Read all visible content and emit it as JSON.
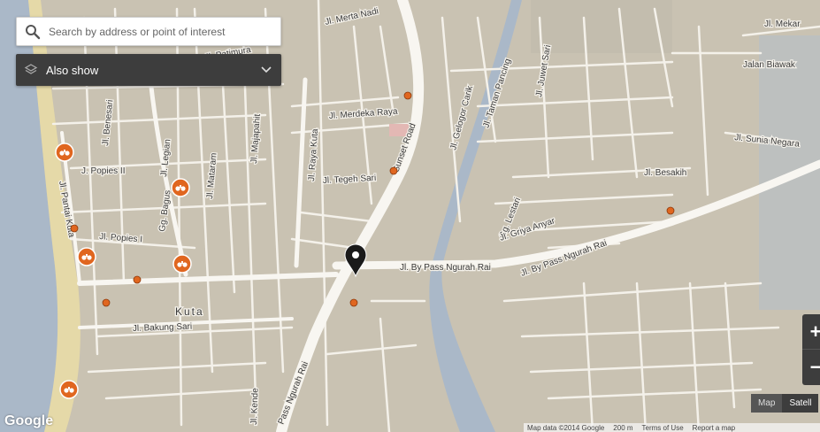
{
  "search": {
    "placeholder": "Search by address or point of interest"
  },
  "also_show": {
    "label": "Also show"
  },
  "zoom": {
    "in": "+",
    "out": "−"
  },
  "map_type": {
    "map": "Map",
    "satellite": "Satell"
  },
  "attribution": {
    "data": "Map data ©2014 Google",
    "scale": "200 m",
    "terms": "Terms of Use",
    "report": "Report a map"
  },
  "logo": {
    "text": "Google"
  },
  "icons": {
    "search": "search-icon",
    "layers": "layers-icon",
    "chevron": "chevron-down-icon",
    "marker": "location-pin-icon",
    "poi": "binoculars-icon"
  },
  "colors": {
    "land": "#c9c2b2",
    "water": "#aab8c8",
    "road": "#f4f1ea",
    "beach": "#e5d9a8",
    "poi": "#e0661f",
    "panel": "#3d3d3d"
  },
  "labels": {
    "merta_nadi": "Jl. Merta Nadi",
    "mekar": "Jl. Mekar",
    "biawak": "Jalan Biawak",
    "juwet": "Jl. Juwet Sari",
    "taman_pancing": "Jl. Taman Pancing",
    "gelogor": "Jl. Gelogor Carik",
    "merdeka": "Jl. Merdeka Raya",
    "sunset": "Sunset Road",
    "benesari": "Jl. Benesari",
    "legian": "Jl. Legian",
    "majapahit": "Jl. Majapahit",
    "raya_kuta": "Jl. Raya Kuta",
    "popies2": "J. Popies II",
    "mataram": "Jl. Mataram",
    "bagus": "Gg. Bagus",
    "tegeh": "Jl. Tegeh Sari",
    "lestari": "Gg. Lestari",
    "besakih": "Jl. Besakih",
    "sunia": "Jl. Sunia Negara",
    "pantai": "Jl. Pantai Kuta",
    "popies1": "Jl. Popies I",
    "griya": "Jl. Griya Anyar",
    "bypass1": "Jl. By Pass Ngurah Rai",
    "bypass2": "Jl. By Pass Ngurah Rai",
    "bypass3": "Pass Ngurah Rai",
    "kuta": "Kuta",
    "bakung": "Jl. Bakung Sari",
    "kende": "Jl. Kende",
    "patimura": "Jl. Patimura"
  }
}
